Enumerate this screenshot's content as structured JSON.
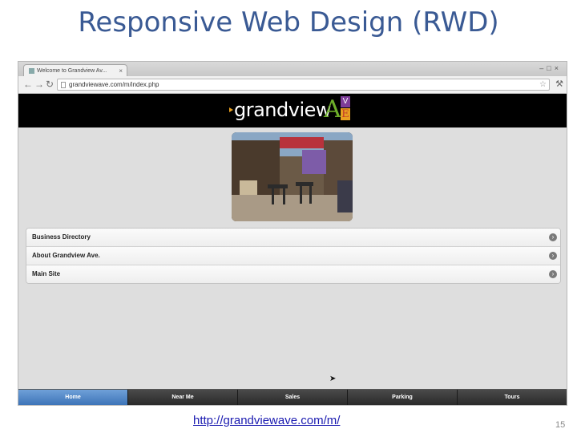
{
  "slide": {
    "title": "Responsive Web Design (RWD)",
    "url_link": "http://grandviewave.com/m/",
    "page_number": "15"
  },
  "browser": {
    "tab_title": "Welcome to Grandview Av...",
    "address": "grandviewave.com/m/index.php"
  },
  "site": {
    "logo_text": "grandview",
    "logo_ave_a": "A",
    "logo_ave_v": "V",
    "logo_ave_e": "E",
    "menu_items": [
      {
        "label": "Business Directory"
      },
      {
        "label": "About Grandview Ave."
      },
      {
        "label": "Main Site"
      }
    ],
    "bottom_nav": [
      {
        "label": "Home",
        "active": true
      },
      {
        "label": "Near Me",
        "active": false
      },
      {
        "label": "Sales",
        "active": false
      },
      {
        "label": "Parking",
        "active": false
      },
      {
        "label": "Tours",
        "active": false
      }
    ]
  },
  "colors": {
    "title": "#3a5a94",
    "active_tab": "#3d74b8",
    "header_bg": "#000000"
  }
}
